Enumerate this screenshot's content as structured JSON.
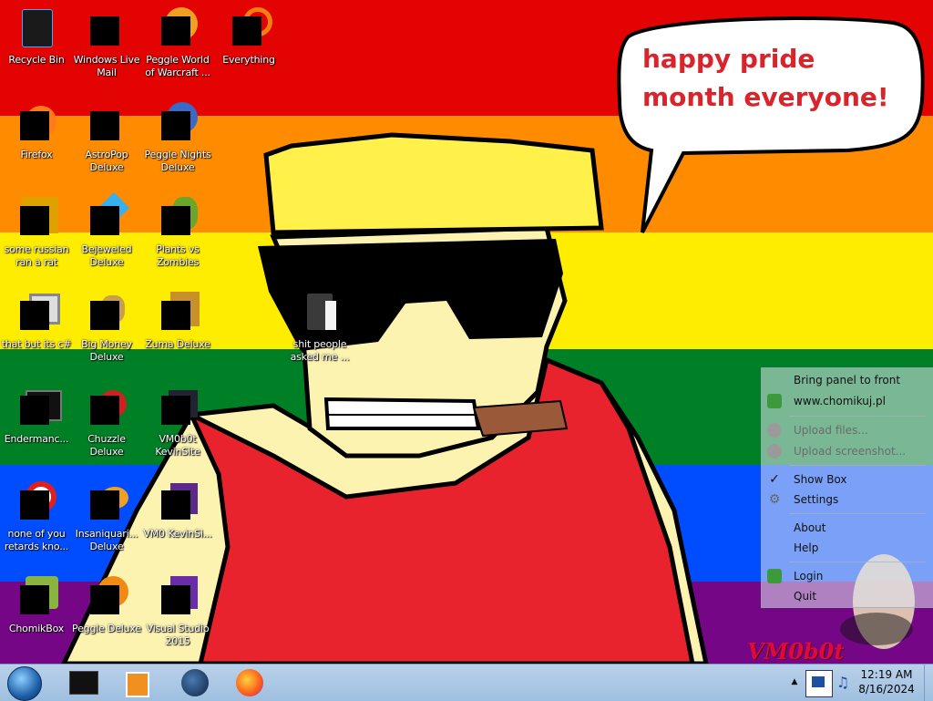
{
  "wallpaper": {
    "bubble_text": "happy pride month everyone!",
    "watermark": "VM0b0t",
    "colors": [
      "#e40303",
      "#ff8c00",
      "#ffed00",
      "#008026",
      "#004dff",
      "#750787"
    ]
  },
  "desktop_icons": [
    {
      "label": "Recycle Bin",
      "icon": "recycle-bin-icon"
    },
    {
      "label": "Windows Live Mail",
      "icon": "mail-icon"
    },
    {
      "label": "Peggle World of Warcraft ...",
      "icon": "peggle-icon"
    },
    {
      "label": "Everything",
      "icon": "search-icon"
    },
    {
      "label": "Firefox",
      "icon": "firefox-icon"
    },
    {
      "label": "AstroPop Deluxe",
      "icon": "game-icon"
    },
    {
      "label": "Peggle Nights Deluxe",
      "icon": "peggle-icon"
    },
    {
      "label": "some russian ran a rat",
      "icon": "app-icon"
    },
    {
      "label": "Bejeweled Deluxe",
      "icon": "gem-icon"
    },
    {
      "label": "Plants vs Zombies",
      "icon": "plant-icon"
    },
    {
      "label": "that but its c#",
      "icon": "app-icon"
    },
    {
      "label": "Big Money Deluxe",
      "icon": "money-bag-icon"
    },
    {
      "label": "Zuma Deluxe",
      "icon": "zuma-icon"
    },
    {
      "label": "shit people asked me ...",
      "icon": "folder-icon"
    },
    {
      "label": "Endermanc...",
      "icon": "terminal-icon"
    },
    {
      "label": "Chuzzle Deluxe",
      "icon": "chuzzle-icon"
    },
    {
      "label": "VM0b0t KevinSite",
      "icon": "app-icon"
    },
    {
      "label": "none of you retards kno...",
      "icon": "opera-icon"
    },
    {
      "label": "Insaniquari... Deluxe",
      "icon": "fish-icon"
    },
    {
      "label": "VM0 KevinSi...",
      "icon": "app-icon"
    },
    {
      "label": "ChomikBox",
      "icon": "hamster-icon"
    },
    {
      "label": "Peggle Deluxe",
      "icon": "peggle-icon"
    },
    {
      "label": "Visual Studio 2015",
      "icon": "visual-studio-icon"
    }
  ],
  "context_menu": {
    "items": [
      {
        "label": "Bring panel to front",
        "icon": "",
        "disabled": false
      },
      {
        "label": "www.chomikuj.pl",
        "icon": "home-icon",
        "disabled": false
      },
      {
        "label": "Upload files...",
        "icon": "upload-icon",
        "disabled": true
      },
      {
        "label": "Upload screenshot...",
        "icon": "screenshot-icon",
        "disabled": true
      },
      {
        "label": "Show Box",
        "icon": "check-icon",
        "disabled": false
      },
      {
        "label": "Settings",
        "icon": "gear-icon",
        "disabled": false
      },
      {
        "label": "About",
        "icon": "",
        "disabled": false
      },
      {
        "label": "Help",
        "icon": "",
        "disabled": false
      },
      {
        "label": "Login",
        "icon": "login-icon",
        "disabled": false
      },
      {
        "label": "Quit",
        "icon": "",
        "disabled": false
      }
    ]
  },
  "taskbar": {
    "start": "start-orb-icon",
    "pinned": [
      "cmd-icon",
      "media-player-icon",
      "globe-icon",
      "firefox-icon"
    ],
    "clock_time": "12:19 AM",
    "clock_date": "8/16/2024"
  }
}
